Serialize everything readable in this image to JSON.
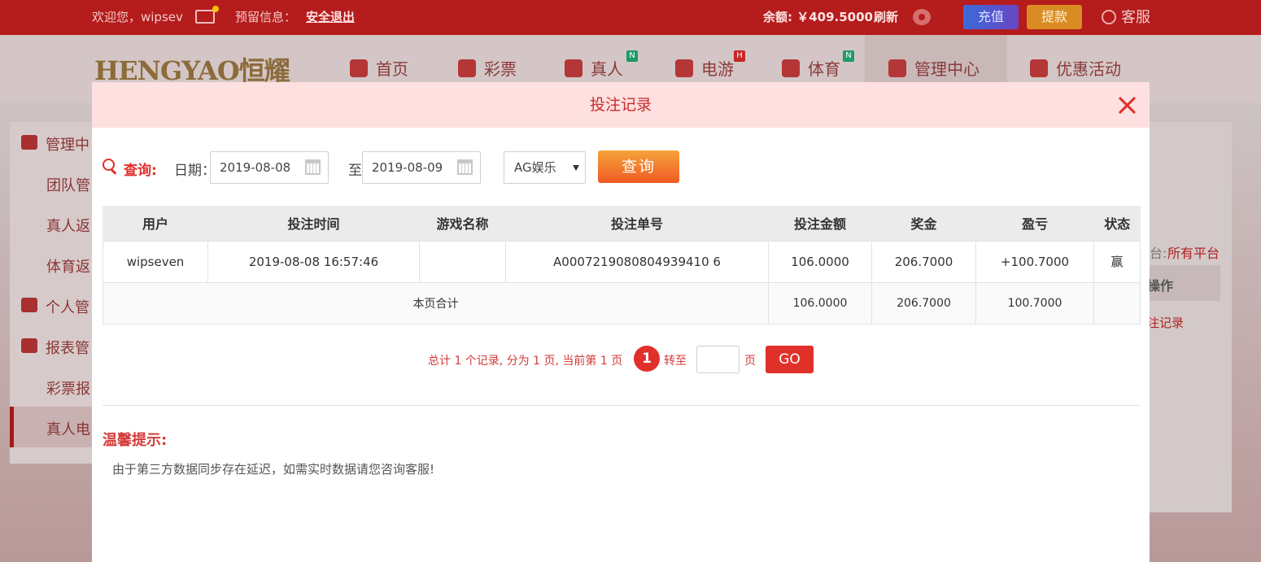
{
  "topbar": {
    "welcome": "欢迎您，wipsev",
    "reserved_info": "预留信息：",
    "logout": "安全退出",
    "balance": "余额: ￥409.5000",
    "refresh": "刷新",
    "charge": "充值",
    "withdraw": "提款",
    "customer_service": "客服"
  },
  "logo_text": "HENGYAO恒耀",
  "nav": [
    {
      "label": "首页",
      "badge": ""
    },
    {
      "label": "彩票",
      "badge": ""
    },
    {
      "label": "真人",
      "badge": "N"
    },
    {
      "label": "电游",
      "badge": "H"
    },
    {
      "label": "体育",
      "badge": "N"
    },
    {
      "label": "管理中心",
      "badge": ""
    },
    {
      "label": "优惠活动",
      "badge": ""
    }
  ],
  "sidebar": {
    "items": [
      "管理中",
      "团队管",
      "真人返",
      "体育返",
      "个人管",
      "报表管",
      "彩票报",
      "真人电"
    ]
  },
  "right_panel": {
    "platform_label": "台:",
    "platform_value": "所有平台",
    "column": "操作",
    "link": "注记录"
  },
  "modal": {
    "title": "投注记录",
    "query_label": "查询:",
    "date_label": "日期：",
    "date_from": "2019-08-08",
    "to_label": "至",
    "date_to": "2019-08-09",
    "platform": "AG娱乐",
    "query_button": "查询",
    "columns": [
      "用户",
      "投注时间",
      "游戏名称",
      "投注单号",
      "投注金额",
      "奖金",
      "盈亏",
      "状态"
    ],
    "rows": [
      {
        "user": "wipseven",
        "time": "2019-08-08 16:57:46",
        "game": "",
        "order": "A0007219080804939410 6",
        "amount": "106.0000",
        "bonus": "206.7000",
        "profit": "+100.7000",
        "status": "赢"
      }
    ],
    "summary": {
      "label": "本页合计",
      "amount": "106.0000",
      "bonus": "206.7000",
      "profit": "100.7000"
    },
    "pager": {
      "text": "总计 1 个记录, 分为 1 页, 当前第 1 页",
      "current": "1",
      "goto": "转至",
      "unit": "页",
      "go": "GO"
    },
    "tip_title": "温馨提示:",
    "tip_text": "由于第三方数据同步存在延迟，如需实时数据请您咨询客服!"
  },
  "colors": {
    "brand_red": "#b51c1c",
    "accent": "#e0302a",
    "win_green": "#1c8a1c"
  }
}
